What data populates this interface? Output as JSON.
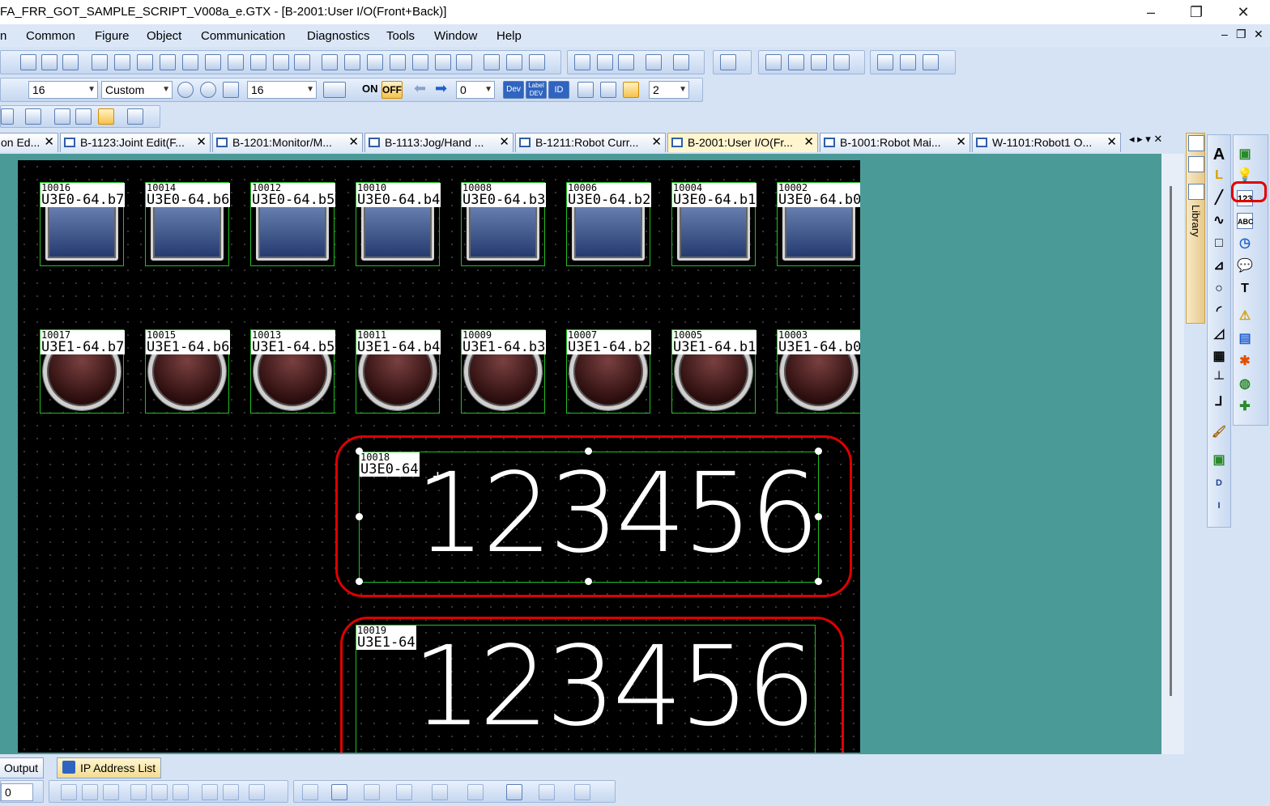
{
  "window": {
    "title": "FA_FRR_GOT_SAMPLE_SCRIPT_V008a_e.GTX - [B-2001:User I/O(Front+Back)]",
    "minimize": "–",
    "maximize": "❐",
    "close": "✕"
  },
  "menu": {
    "items": [
      "n",
      "Common",
      "Figure",
      "Object",
      "Communication",
      "Diagnostics",
      "Tools",
      "Window",
      "Help"
    ],
    "mdi_min": "–",
    "mdi_restore": "❐",
    "mdi_close": "✕"
  },
  "toolbar": {
    "font_size": "16",
    "style_combo": "Custom",
    "zoom_combo": "16",
    "on_label": "ON",
    "off_label": "OFF",
    "step_value": "0",
    "dev_label": "Dev",
    "label_label": "Label DEV",
    "id_label": "ID",
    "layer_value": "2"
  },
  "tabs": [
    {
      "label": "on Ed...",
      "active": false
    },
    {
      "label": "B-1123:Joint Edit(F...",
      "active": false
    },
    {
      "label": "B-1201:Monitor/M...",
      "active": false
    },
    {
      "label": "B-1113:Jog/Hand ...",
      "active": false
    },
    {
      "label": "B-1211:Robot Curr...",
      "active": false
    },
    {
      "label": "B-2001:User I/O(Fr...",
      "active": true
    },
    {
      "label": "B-1001:Robot Mai...",
      "active": false
    },
    {
      "label": "W-1101:Robot1 O...",
      "active": false
    }
  ],
  "tab_close": "✕",
  "tab_nav": "◂ ▸ ▾ ✕",
  "lamps_row1": [
    {
      "id": "10016",
      "dev": "U3E0-64.b7"
    },
    {
      "id": "10014",
      "dev": "U3E0-64.b6"
    },
    {
      "id": "10012",
      "dev": "U3E0-64.b5"
    },
    {
      "id": "10010",
      "dev": "U3E0-64.b4"
    },
    {
      "id": "10008",
      "dev": "U3E0-64.b3"
    },
    {
      "id": "10006",
      "dev": "U3E0-64.b2"
    },
    {
      "id": "10004",
      "dev": "U3E0-64.b1"
    },
    {
      "id": "10002",
      "dev": "U3E0-64.b0"
    }
  ],
  "lamps_row2": [
    {
      "id": "10017",
      "dev": "U3E1-64.b7"
    },
    {
      "id": "10015",
      "dev": "U3E1-64.b6"
    },
    {
      "id": "10013",
      "dev": "U3E1-64.b5"
    },
    {
      "id": "10011",
      "dev": "U3E1-64.b4"
    },
    {
      "id": "10009",
      "dev": "U3E1-64.b3"
    },
    {
      "id": "10007",
      "dev": "U3E1-64.b2"
    },
    {
      "id": "10005",
      "dev": "U3E1-64.b1"
    },
    {
      "id": "10003",
      "dev": "U3E1-64.b0"
    }
  ],
  "numeric_displays": [
    {
      "id": "10018",
      "dev": "U3E0-64",
      "value": "123456",
      "selected": true
    },
    {
      "id": "10019",
      "dev": "U3E1-64",
      "value": "123456",
      "selected": false
    }
  ],
  "library_tab": "Library",
  "palette": {
    "left": [
      "text-icon",
      "line-freeform-icon",
      "line-icon",
      "polyline-icon",
      "rectangle-icon",
      "polygon-icon",
      "circle-icon",
      "arc-icon",
      "sector-icon",
      "table-icon",
      "scale-icon",
      "piping-icon",
      "paint-icon",
      "image-icon",
      "dxf-icon",
      "iges-icon"
    ],
    "left_glyphs": [
      "A",
      "L",
      "╱",
      "∿",
      "□",
      "⊿",
      "○",
      "◜",
      "◿",
      "▦",
      "┴",
      "⅃",
      "🖌",
      "▣",
      "D",
      "I"
    ],
    "right_glyphs": [
      "▣",
      "💡",
      "123",
      "ABC",
      "◷",
      "💬",
      "T",
      "⚠",
      "▤",
      "✱",
      "◍",
      "✚"
    ],
    "highlight_label": "123"
  },
  "bottom": {
    "output_tab": "Output",
    "ip_tab": "IP Address List",
    "spin_value": "0"
  }
}
